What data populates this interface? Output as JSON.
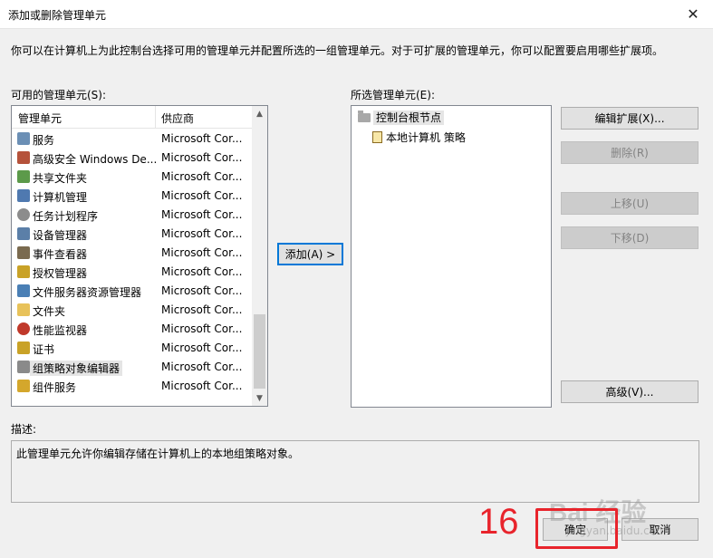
{
  "window": {
    "title": "添加或删除管理单元",
    "close_glyph": "✕"
  },
  "intro_text": "你可以在计算机上为此控制台选择可用的管理单元并配置所选的一组管理单元。对于可扩展的管理单元，你可以配置要启用哪些扩展项。",
  "available": {
    "label": "可用的管理单元(S):",
    "col_name": "管理单元",
    "col_vendor": "供应商",
    "items": [
      {
        "name": "服务",
        "vendor": "Microsoft Cor...",
        "icon": "gear-icon",
        "color": "#6b8fb5"
      },
      {
        "name": "高级安全 Windows De...",
        "vendor": "Microsoft Cor...",
        "icon": "firewall-icon",
        "color": "#b5523b"
      },
      {
        "name": "共享文件夹",
        "vendor": "Microsoft Cor...",
        "icon": "shared-folder-icon",
        "color": "#5c9a4a"
      },
      {
        "name": "计算机管理",
        "vendor": "Microsoft Cor...",
        "icon": "computer-management-icon",
        "color": "#4f79b0"
      },
      {
        "name": "任务计划程序",
        "vendor": "Microsoft Cor...",
        "icon": "clock-icon",
        "color": "#8c8c8c"
      },
      {
        "name": "设备管理器",
        "vendor": "Microsoft Cor...",
        "icon": "device-manager-icon",
        "color": "#5b7fa8"
      },
      {
        "name": "事件查看器",
        "vendor": "Microsoft Cor...",
        "icon": "event-viewer-icon",
        "color": "#7a6a4f"
      },
      {
        "name": "授权管理器",
        "vendor": "Microsoft Cor...",
        "icon": "authorization-icon",
        "color": "#c9a227"
      },
      {
        "name": "文件服务器资源管理器",
        "vendor": "Microsoft Cor...",
        "icon": "file-server-icon",
        "color": "#4a7fb5"
      },
      {
        "name": "文件夹",
        "vendor": "Microsoft Cor...",
        "icon": "folder-icon",
        "color": "#e8c25a"
      },
      {
        "name": "性能监视器",
        "vendor": "Microsoft Cor...",
        "icon": "performance-icon",
        "color": "#c0392b"
      },
      {
        "name": "证书",
        "vendor": "Microsoft Cor...",
        "icon": "certificate-icon",
        "color": "#c9a227"
      },
      {
        "name": "组策略对象编辑器",
        "vendor": "Microsoft Cor...",
        "icon": "group-policy-icon",
        "color": "#8a8a8a",
        "selected": true
      },
      {
        "name": "组件服务",
        "vendor": "Microsoft Cor...",
        "icon": "component-services-icon",
        "color": "#d4a72c"
      }
    ]
  },
  "add_button": "添加(A) >",
  "selected": {
    "label": "所选管理单元(E):",
    "root": "控制台根节点",
    "child": "本地计算机 策略"
  },
  "buttons": {
    "edit_ext": "编辑扩展(X)...",
    "remove": "删除(R)",
    "move_up": "上移(U)",
    "move_down": "下移(D)",
    "advanced": "高级(V)...",
    "ok": "确定",
    "cancel": "取消"
  },
  "description": {
    "label": "描述:",
    "text": "此管理单元允许你编辑存储在计算机上的本地组策略对象。"
  },
  "annotation": {
    "step": "16",
    "accent": "#e8242c"
  },
  "watermark": {
    "main": "Bai 经验",
    "sub": "jingyan.baidu.com"
  }
}
